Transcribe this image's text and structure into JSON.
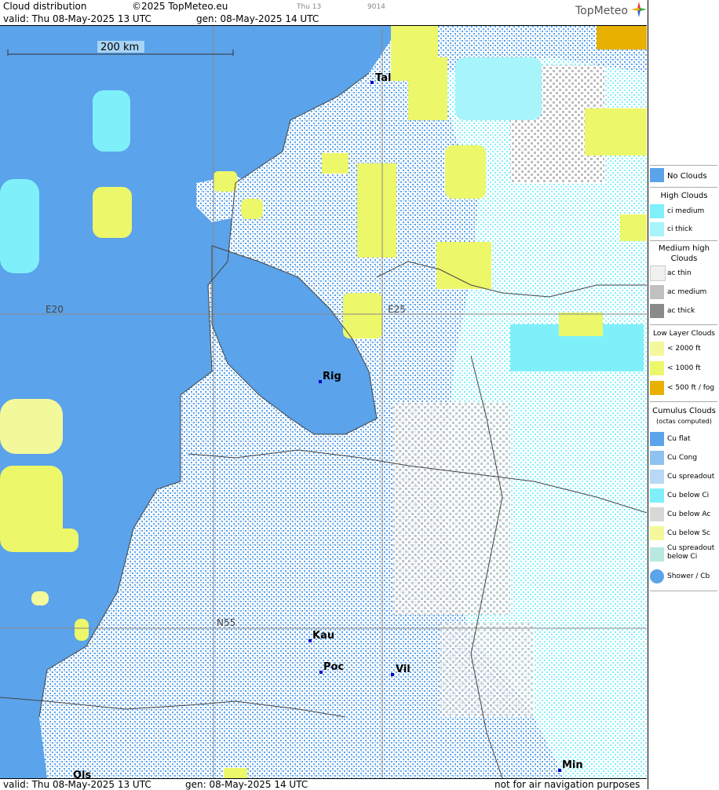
{
  "header": {
    "title": "Cloud distribution",
    "copyright": "©2025 TopMeteo.eu",
    "valid": "valid:  Thu  08-May-2025  13 UTC",
    "gen": "gen: 08-May-2025 14 UTC",
    "frame_label": "Thu 13",
    "frame_code": "9014",
    "logo": "TopMeteo"
  },
  "footer": {
    "valid": "valid:  Thu  08-May-2025  13 UTC",
    "gen": "gen: 08-May-2025 14 UTC",
    "disclaimer": "not for air navigation purposes"
  },
  "map": {
    "scale_label": "200 km",
    "grid_labels": {
      "lon1": "E20",
      "lon2": "E25",
      "lat": "N55"
    },
    "cities": [
      {
        "code": "Tal"
      },
      {
        "code": "Rig"
      },
      {
        "code": "Kau"
      },
      {
        "code": "Poc"
      },
      {
        "code": "Vil"
      },
      {
        "code": "Ols"
      },
      {
        "code": "Min"
      }
    ],
    "colors": {
      "no_clouds": "#5ba3ea",
      "ci_medium": "#7ff0fa",
      "ci_thick": "#a8f4fb",
      "low_2000": "#f3f99a",
      "low_1000": "#ecf76a",
      "low_500": "#e8b000",
      "ac_medium": "#c0c0c0",
      "cu": "#ffffff"
    }
  },
  "legend": {
    "no_clouds": "No Clouds",
    "high_title": "High Clouds",
    "ci_medium": "ci medium",
    "ci_thick": "ci thick",
    "medium_title_1": "Medium high",
    "medium_title_2": "Clouds",
    "ac_thin": "ac thin",
    "ac_medium": "ac medium",
    "ac_thick": "ac thick",
    "low_title": "Low Layer Clouds",
    "low_2000": "< 2000 ft",
    "low_1000": "< 1000 ft",
    "low_500": "< 500 ft / fog",
    "cu_title": "Cumulus Clouds",
    "cu_sub": "(octas computed)",
    "cu_flat": "Cu flat",
    "cu_cong": "Cu Cong",
    "cu_spreadout": "Cu spreadout",
    "cu_below_ci": "Cu below Ci",
    "cu_below_ac": "Cu below Ac",
    "cu_below_sc": "Cu below Sc",
    "cu_spreadout_ci_1": "Cu spreadout",
    "cu_spreadout_ci_2": "below Ci",
    "shower": "Shower / Cb"
  }
}
